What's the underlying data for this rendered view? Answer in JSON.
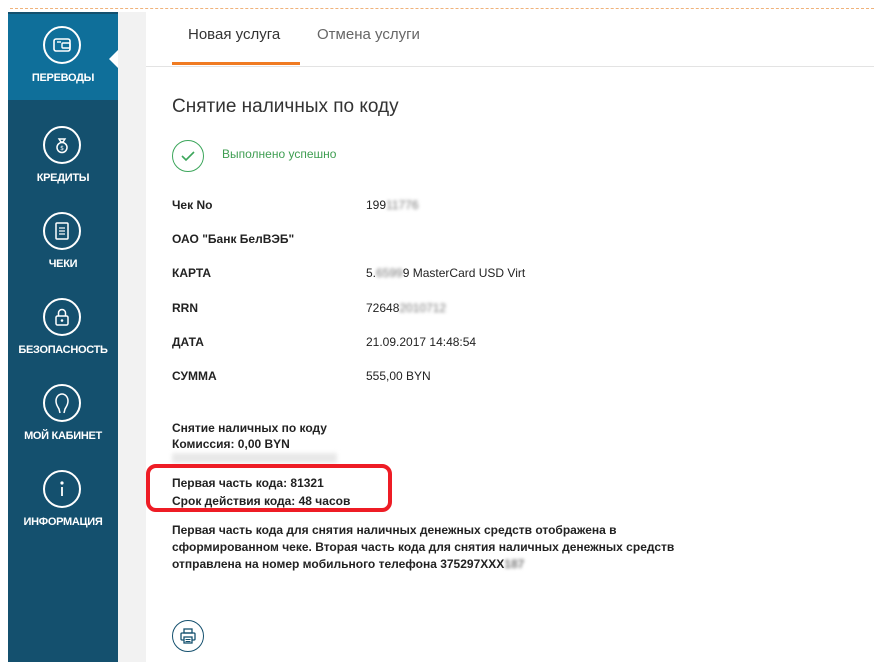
{
  "sidebar": {
    "items": [
      {
        "label": "ПЕРЕВОДЫ",
        "icon": "wallet-icon",
        "active": true
      },
      {
        "label": "КРЕДИТЫ",
        "icon": "money-bag-icon",
        "active": false
      },
      {
        "label": "ЧЕКИ",
        "icon": "receipt-icon",
        "active": false
      },
      {
        "label": "БЕЗОПАСНОСТЬ",
        "icon": "lock-icon",
        "active": false
      },
      {
        "label": "МОЙ КАБИНЕТ",
        "icon": "user-icon",
        "active": false
      },
      {
        "label": "ИНФОРМАЦИЯ",
        "icon": "info-icon",
        "active": false
      }
    ]
  },
  "tabs": [
    {
      "label": "Новая услуга",
      "active": true
    },
    {
      "label": "Отмена услуги",
      "active": false
    }
  ],
  "page": {
    "title": "Снятие наличных по коду",
    "status": "Выполнено успешно"
  },
  "receipt": {
    "rows": [
      {
        "label": "Чек No",
        "value": "199",
        "value_blurred": "11776"
      },
      {
        "label": "ОАО \"Банк БелВЭБ\"",
        "value": "",
        "value_blurred": ""
      },
      {
        "label": "КАРТА",
        "value": "5.",
        "value_blurred": "6599",
        "value_suffix": "9 MasterCard USD Virt"
      },
      {
        "label": "RRN",
        "value": "72648",
        "value_blurred": "2010712"
      },
      {
        "label": "ДАТА",
        "value": "21.09.2017 14:48:54",
        "value_blurred": ""
      },
      {
        "label": "СУММА",
        "value": "555,00 BYN",
        "value_blurred": ""
      }
    ]
  },
  "details": {
    "service": "Снятие наличных по коду",
    "commission": "Комиссия: 0,00 BYN",
    "code_first_part": "Первая часть кода: 81321",
    "code_validity": "Срок действия кода: 48 часов",
    "note": "Первая часть кода для снятия наличных денежных средств отображена в сформированном чеке. Вторая часть кода для снятия наличных денежных средств отправлена на номер мобильного телефона 375297XXX",
    "note_blurred": "187"
  },
  "colors": {
    "sidebar_bg": "#14506e",
    "sidebar_active": "#0f6f9a",
    "tab_accent": "#f07b22",
    "success": "#3ca65b",
    "highlight": "#ee1c25"
  }
}
